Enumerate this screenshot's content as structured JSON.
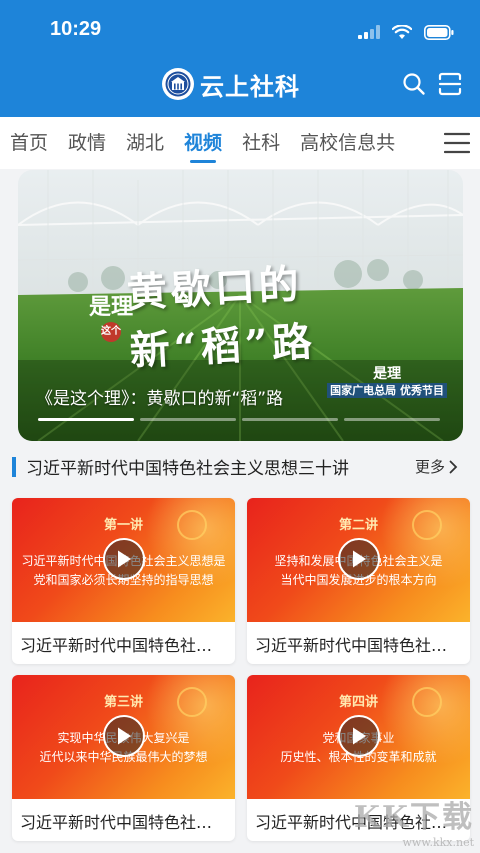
{
  "status_bar": {
    "time": "10:29"
  },
  "app_bar": {
    "title": "云上社科",
    "logo": "emblem-logo",
    "actions": [
      "search-icon",
      "scan-icon"
    ]
  },
  "tabs": [
    {
      "label": "首页",
      "active": false
    },
    {
      "label": "政情",
      "active": false
    },
    {
      "label": "湖北",
      "active": false
    },
    {
      "label": "视频",
      "active": true
    },
    {
      "label": "社科",
      "active": false
    },
    {
      "label": "高校信息共",
      "active": false
    }
  ],
  "banner": {
    "art_title": "黄歇口的新“稻”路",
    "seal_text": "是理",
    "seal_mark": "这个",
    "caption": "《是这个理》：黄歇口的新“稻”路",
    "corner_logo": "是理",
    "corner_tag": "国家广电总局 优秀节目",
    "slide_count": 4,
    "active_slide": 0
  },
  "section": {
    "title": "习近平新时代中国特色社会主义思想三十讲",
    "more": "更多"
  },
  "cards": [
    {
      "lecture": "第一讲",
      "line1": "习近平新时代中国特色社会主义思想是",
      "line2": "党和国家必须长期坚持的指导思想",
      "title": "习近平新时代中国特色社会主义思想三十讲"
    },
    {
      "lecture": "第二讲",
      "line1": "坚持和发展中国特色社会主义是",
      "line2": "当代中国发展进步的根本方向",
      "title": "习近平新时代中国特色社会主义思想三十讲"
    },
    {
      "lecture": "第三讲",
      "line1": "实现中华民族伟大复兴是",
      "line2": "近代以来中华民族最伟大的梦想",
      "title": "习近平新时代中国特色社会主义思想三十讲"
    },
    {
      "lecture": "第四讲",
      "line1": "党和国家事业",
      "line2": "历史性、根本性的变革和成就",
      "title": "习近平新时代中国特色社会主义思想三十讲"
    }
  ],
  "watermark": {
    "brand": "KK下载",
    "url": "www.kkx.net"
  },
  "colors": {
    "primary": "#1e84d9",
    "card_red": "#e8231c",
    "card_orange": "#fbb32b"
  }
}
